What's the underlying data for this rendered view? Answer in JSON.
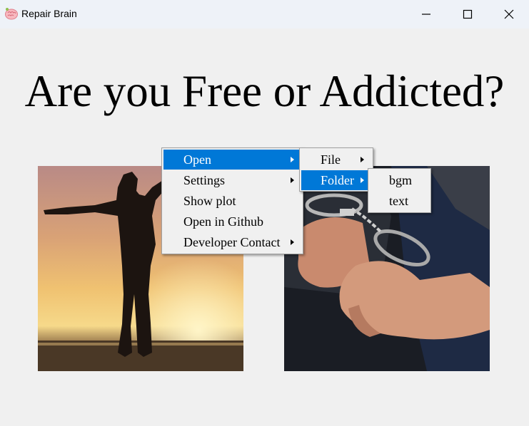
{
  "window": {
    "title": "Repair Brain"
  },
  "main": {
    "heading": "Are you Free or Addicted?"
  },
  "images": [
    {
      "name": "free-image",
      "icon": "silhouette-sunset"
    },
    {
      "name": "addicted-image",
      "icon": "handcuffed-hands"
    }
  ],
  "context_menu": {
    "items": [
      {
        "label": "Open",
        "has_submenu": true,
        "active": true
      },
      {
        "label": "Settings",
        "has_submenu": true,
        "active": false
      },
      {
        "label": "Show plot",
        "has_submenu": false,
        "active": false
      },
      {
        "label": "Open in Github",
        "has_submenu": false,
        "active": false
      },
      {
        "label": "Developer Contact",
        "has_submenu": true,
        "active": false
      }
    ],
    "open_submenu": {
      "items": [
        {
          "label": "File",
          "has_submenu": true,
          "active": false
        },
        {
          "label": "Folder",
          "has_submenu": true,
          "active": true
        }
      ]
    },
    "folder_submenu": {
      "items": [
        {
          "label": "bgm",
          "has_submenu": false,
          "active": false
        },
        {
          "label": "text",
          "has_submenu": false,
          "active": false
        }
      ]
    }
  },
  "colors": {
    "menu_highlight": "#0078d7",
    "window_background": "#f0f0f0",
    "titlebar_background": "#eef2f8"
  }
}
